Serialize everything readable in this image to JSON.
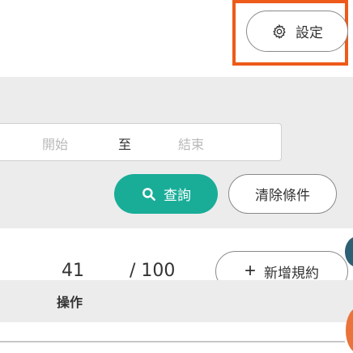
{
  "header": {
    "settings_label": "設定",
    "settings_icon": "gear-icon"
  },
  "filter": {
    "date_start_placeholder": "開始",
    "date_separator": "至",
    "date_end_placeholder": "結束",
    "search_label": "查詢",
    "search_icon": "search-icon",
    "clear_label": "清除條件"
  },
  "summary": {
    "count": "41",
    "total": "/ 100",
    "add_label": "新增規約",
    "add_icon": "plus-icon"
  },
  "table": {
    "columns": [
      "操作"
    ]
  },
  "colors": {
    "accent": "#19ad98",
    "highlight": "#ee5a1a",
    "panel": "#ececec"
  }
}
